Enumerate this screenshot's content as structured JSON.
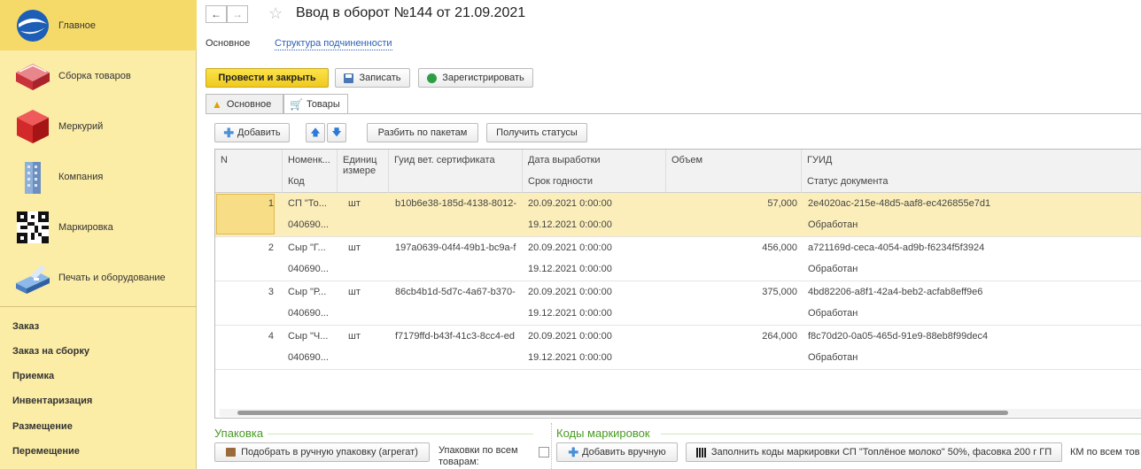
{
  "sidebar": {
    "sections": [
      {
        "label": "Главное",
        "icon": "globe-icon"
      },
      {
        "label": "Сборка товаров",
        "icon": "box-assembly-icon"
      },
      {
        "label": "Меркурий",
        "icon": "red-cube-icon"
      },
      {
        "label": "Компания",
        "icon": "building-icon"
      },
      {
        "label": "Маркировка",
        "icon": "qr-code-icon"
      },
      {
        "label": "Печать и оборудование",
        "icon": "printer-icon"
      }
    ],
    "links": [
      "Заказ",
      "Заказ на сборку",
      "Приемка",
      "Инвентаризация",
      "Размещение",
      "Перемещение"
    ]
  },
  "header": {
    "back": "←",
    "forward": "→",
    "star": "☆",
    "title": "Ввод в оборот №144 от 21.09.2021"
  },
  "subtabs": {
    "main": "Основное",
    "structure": "Структура подчиненности"
  },
  "toolbar": {
    "post_close": "Провести и закрыть",
    "save": "Записать",
    "register": "Зарегистрировать"
  },
  "tabs": {
    "basic": "Основное",
    "goods": "Товары"
  },
  "gridbar": {
    "add": "Добавить",
    "split": "Разбить по пакетам",
    "status": "Получить статусы"
  },
  "table": {
    "headers": {
      "n": "N",
      "nom": "Номенк...",
      "code": "Код",
      "unit1": "Единиц",
      "unit2": "измере",
      "guid_cert": "Гуид вет. сертификата",
      "date": "Дата выработки",
      "expiry": "Срок годности",
      "volume": "Объем",
      "guid": "ГУИД",
      "doc_status": "Статус документа"
    },
    "rows": [
      {
        "n": "1",
        "nom": "СП \"То...",
        "code": "040690...",
        "unit": "шт",
        "cert": "b10b6e38-185d-4138-8012-",
        "date": "20.09.2021 0:00:00",
        "expiry": "19.12.2021 0:00:00",
        "volume": "57,000",
        "guid": "2e4020ac-215e-48d5-aaf8-ec426855e7d1",
        "status": "Обработан"
      },
      {
        "n": "2",
        "nom": "Сыр \"Г...",
        "code": "040690...",
        "unit": "шт",
        "cert": "197a0639-04f4-49b1-bc9a-f",
        "date": "20.09.2021 0:00:00",
        "expiry": "19.12.2021 0:00:00",
        "volume": "456,000",
        "guid": "a721169d-ceca-4054-ad9b-f6234f5f3924",
        "status": "Обработан"
      },
      {
        "n": "3",
        "nom": "Сыр \"Р...",
        "code": "040690...",
        "unit": "шт",
        "cert": "86cb4b1d-5d7c-4a67-b370-",
        "date": "20.09.2021 0:00:00",
        "expiry": "19.12.2021 0:00:00",
        "volume": "375,000",
        "guid": "4bd82206-a8f1-42a4-beb2-acfab8eff9e6",
        "status": "Обработан"
      },
      {
        "n": "4",
        "nom": "Сыр \"Ч...",
        "code": "040690...",
        "unit": "шт",
        "cert": "f7179ffd-b43f-41c3-8cc4-ed",
        "date": "20.09.2021 0:00:00",
        "expiry": "19.12.2021 0:00:00",
        "volume": "264,000",
        "guid": "f8c70d20-0a05-465d-91e9-88eb8f99dec4",
        "status": "Обработан"
      }
    ]
  },
  "packing": {
    "title": "Упаковка",
    "pick": "Подобрать в ручную упаковку (агрегат)",
    "all_label": "Упаковки по всем товарам:"
  },
  "codes": {
    "title": "Коды маркировок",
    "add_manual": "Добавить вручную",
    "fill": "Заполнить коды маркировки СП \"Топлёное молоко\" 50%, фасовка 200 г ГП",
    "km_all": "КМ по всем тов"
  }
}
